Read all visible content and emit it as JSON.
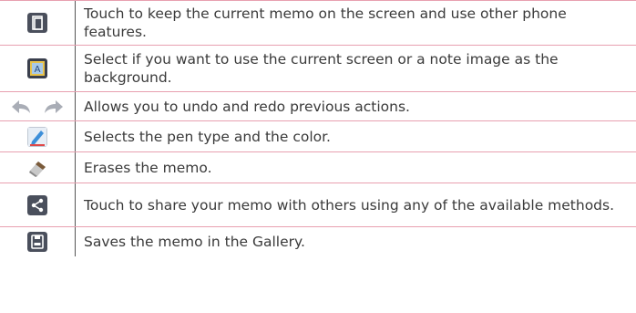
{
  "rows": [
    {
      "icon": "multitask-window-icon",
      "text": "Touch to keep the current memo on the screen and use other phone features."
    },
    {
      "icon": "background-image-icon",
      "text": "Select if you want to use the current screen or a note image as the background."
    },
    {
      "icon": "undo-redo-icons",
      "text": "Allows you to undo and redo previous actions."
    },
    {
      "icon": "pen-icon",
      "text": "Selects the pen type and the color."
    },
    {
      "icon": "eraser-icon",
      "text": "Erases the memo."
    },
    {
      "icon": "share-icon",
      "text": "Touch to share your memo with others using any of the available methods."
    },
    {
      "icon": "save-icon",
      "text": "Saves the memo in the Gallery."
    }
  ],
  "colors": {
    "divider": "#e8a0b0",
    "text": "#3a3a3a",
    "icon_bg": "#4a4f5c"
  }
}
